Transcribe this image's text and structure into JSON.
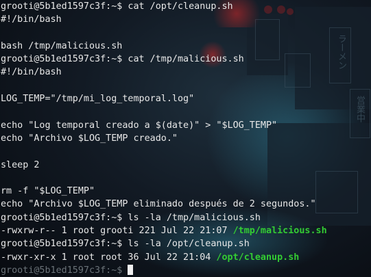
{
  "terminal": {
    "lines": [
      {
        "text": "grooti@5b1ed1597c3f:~$ cat /opt/cleanup.sh"
      },
      {
        "text": "#!/bin/bash"
      },
      {
        "text": ""
      },
      {
        "text": "bash /tmp/malicious.sh"
      },
      {
        "text": "grooti@5b1ed1597c3f:~$ cat /tmp/malicious.sh"
      },
      {
        "text": "#!/bin/bash"
      },
      {
        "text": ""
      },
      {
        "text": "LOG_TEMP=\"/tmp/mi_log_temporal.log\""
      },
      {
        "text": ""
      },
      {
        "text": "echo \"Log temporal creado a $(date)\" > \"$LOG_TEMP\""
      },
      {
        "text": "echo \"Archivo $LOG_TEMP creado.\""
      },
      {
        "text": ""
      },
      {
        "text": "sleep 2"
      },
      {
        "text": ""
      },
      {
        "text": "rm -f \"$LOG_TEMP\""
      },
      {
        "text": "echo \"Archivo $LOG_TEMP eliminado después de 2 segundos.\""
      },
      {
        "text": "grooti@5b1ed1597c3f:~$ ls -la /tmp/malicious.sh"
      },
      {
        "text": "-rwxrw-r-- 1 root grooti 221 Jul 22 21:07 ",
        "highlight": "/tmp/malicious.sh"
      },
      {
        "text": "grooti@5b1ed1597c3f:~$ ls -la /opt/cleanup.sh"
      },
      {
        "text": "-rwxr-xr-x 1 root root 36 Jul 22 21:04 ",
        "highlight": "/opt/cleanup.sh"
      },
      {
        "text": "grooti@5b1ed1597c3f:~$ "
      }
    ]
  },
  "colors": {
    "background": "#0d1118",
    "text": "#e8e8e8",
    "executable": "#33cc33",
    "cursor": "#f0f0f0"
  }
}
